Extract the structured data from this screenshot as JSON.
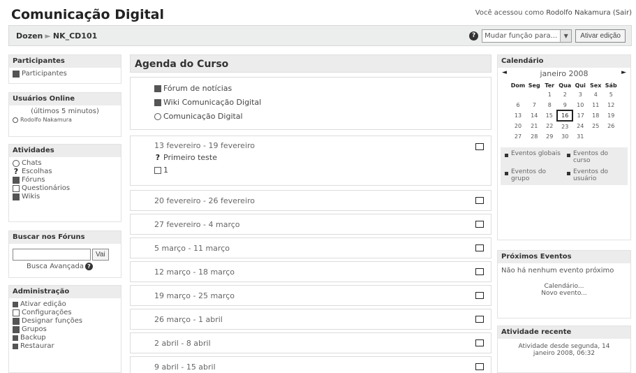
{
  "header": {
    "title": "Comunicação Digital",
    "login_text": "Você acessou como ",
    "user_name": "Rodolfo Nakamura",
    "logout_label": "(Sair)"
  },
  "navbar": {
    "crumbs": [
      "Dozen",
      "NK_CD101"
    ],
    "separator": "►",
    "role_select": "Mudar função para...",
    "edit_button": "Ativar edição"
  },
  "left": {
    "participants": {
      "title": "Participantes",
      "items": [
        "Participantes"
      ]
    },
    "online": {
      "title": "Usuários Online",
      "subtitle": "(últimos 5 minutos)",
      "users": [
        "Rodolfo Nakamura"
      ]
    },
    "activities": {
      "title": "Atividades",
      "items": [
        "Chats",
        "Escolhas",
        "Fóruns",
        "Questionários",
        "Wikis"
      ]
    },
    "search": {
      "title": "Buscar nos Fóruns",
      "button": "Vai",
      "advanced": "Busca Avançada"
    },
    "admin": {
      "title": "Administração",
      "items": [
        "Ativar edição",
        "Configurações",
        "Designar funções",
        "Grupos",
        "Backup",
        "Restaurar"
      ]
    }
  },
  "main": {
    "title": "Agenda do Curso",
    "intro_items": [
      "Fórum de notícias",
      "Wiki Comunicação Digital",
      "Comunicação Digital"
    ],
    "weeks": [
      {
        "date": "13 fevereiro - 19 fevereiro",
        "items": [
          "Primeiro teste",
          "1"
        ]
      },
      {
        "date": "20 fevereiro - 26 fevereiro"
      },
      {
        "date": "27 fevereiro - 4 março"
      },
      {
        "date": "5 março - 11 março"
      },
      {
        "date": "12 março - 18 março"
      },
      {
        "date": "19 março - 25 março"
      },
      {
        "date": "26 março - 1 abril"
      },
      {
        "date": "2 abril - 8 abril"
      },
      {
        "date": "9 abril - 15 abril"
      }
    ]
  },
  "right": {
    "calendar": {
      "title": "Calendário",
      "month": "janeiro 2008",
      "prev": "◄",
      "next": "►",
      "weekdays": [
        "Dom",
        "Seg",
        "Ter",
        "Qua",
        "Qui",
        "Sex",
        "Sáb"
      ],
      "weeks": [
        [
          "",
          "",
          "1",
          "2",
          "3",
          "4",
          "5"
        ],
        [
          "6",
          "7",
          "8",
          "9",
          "10",
          "11",
          "12"
        ],
        [
          "13",
          "14",
          "15",
          "16",
          "17",
          "18",
          "19"
        ],
        [
          "20",
          "21",
          "22",
          "23",
          "24",
          "25",
          "26"
        ],
        [
          "27",
          "28",
          "29",
          "30",
          "31",
          "",
          ""
        ]
      ],
      "today": "16",
      "legend": [
        "Eventos globais",
        "Eventos do curso",
        "Eventos do grupo",
        "Eventos do usuário"
      ]
    },
    "upcoming": {
      "title": "Próximos Eventos",
      "none_text": "Não há nenhum evento próximo",
      "links": [
        "Calendário...",
        "Novo evento..."
      ]
    },
    "recent": {
      "title": "Atividade recente",
      "text": "Atividade desde segunda, 14 janeiro 2008, 06:32"
    }
  }
}
